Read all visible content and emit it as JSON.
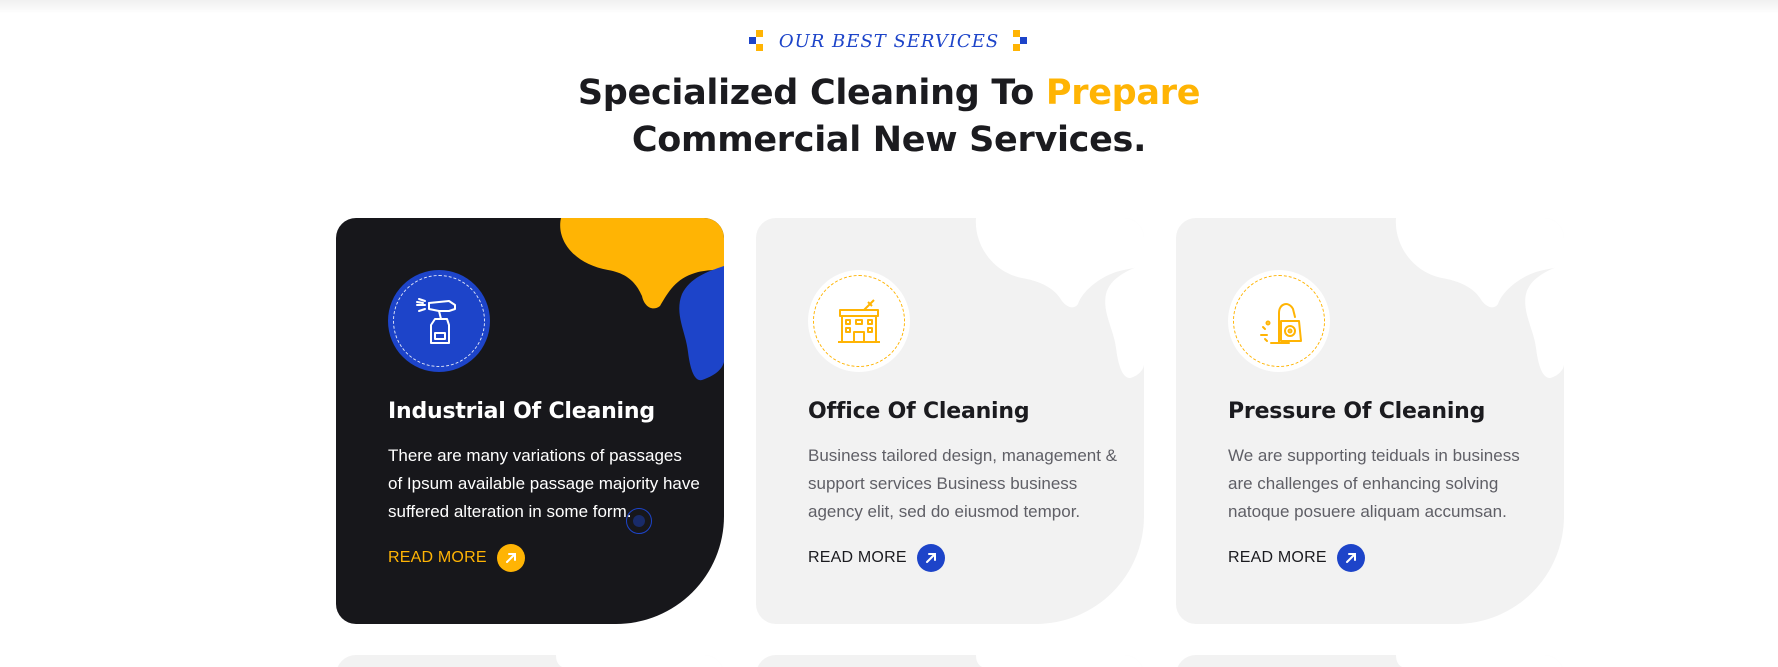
{
  "section": {
    "eyebrow": "OUR BEST SERVICES",
    "heading_part1": "Specialized Cleaning To ",
    "heading_accent": "Prepare",
    "heading_line2": "Commercial New Services."
  },
  "colors": {
    "accent_yellow": "#ffb404",
    "brand_blue": "#1d44c9",
    "dark_card": "#17171b",
    "light_card": "#f2f2f2"
  },
  "cards": [
    {
      "title": "Industrial Of Cleaning",
      "description": "There are many variations of passages of Ipsum available passage majority have suffered alteration in some form.",
      "link": "READ MORE",
      "icon": "spray-bottle-icon",
      "active": true
    },
    {
      "title": "Office Of Cleaning",
      "description": "Business tailored design, management & support services Business business agency elit, sed do eiusmod tempor.",
      "link": "READ MORE",
      "icon": "building-icon",
      "active": false
    },
    {
      "title": "Pressure Of Cleaning",
      "description": "We are supporting teiduals in business are challenges of enhancing solving natoque posuere aliquam accumsan.",
      "link": "READ MORE",
      "icon": "vacuum-cleaner-icon",
      "active": false
    }
  ]
}
